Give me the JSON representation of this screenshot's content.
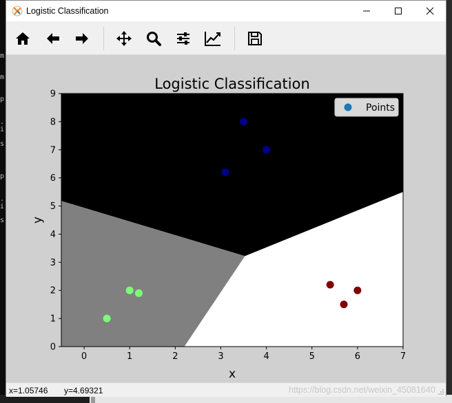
{
  "window": {
    "title": "Logistic Classification",
    "controls": [
      "minimize",
      "maximize",
      "close"
    ]
  },
  "toolbar": {
    "buttons": [
      {
        "icon": "home-icon"
      },
      {
        "icon": "back-arrow-icon"
      },
      {
        "icon": "forward-arrow-icon"
      },
      {
        "icon": "pan-icon"
      },
      {
        "icon": "zoom-icon"
      },
      {
        "icon": "configure-subplots-icon"
      },
      {
        "icon": "edit-axis-icon"
      },
      {
        "icon": "save-icon"
      }
    ]
  },
  "console": {
    "chars": [
      "m",
      "m",
      "p",
      ".",
      "i",
      "s",
      "p",
      ".",
      "i",
      "s"
    ]
  },
  "status": {
    "x": "x=1.05746",
    "y": "y=4.69321",
    "watermark": "https://blog.csdn.net/weixin_45081640"
  },
  "chart_data": {
    "type": "scatter",
    "title": "Logistic Classification",
    "xlabel": "x",
    "ylabel": "y",
    "xlim": [
      -0.5,
      7
    ],
    "ylim": [
      0,
      9
    ],
    "xticks": [
      "0",
      "1",
      "2",
      "3",
      "4",
      "5",
      "6",
      "7"
    ],
    "yticks": [
      "0",
      "1",
      "2",
      "3",
      "4",
      "5",
      "6",
      "7",
      "8",
      "9"
    ],
    "legend": {
      "label": "Points",
      "position": "top-right"
    },
    "background_regions": [
      {
        "class": "top",
        "color": "#000000"
      },
      {
        "class": "left",
        "color": "#808080"
      },
      {
        "class": "right",
        "color": "#ffffff"
      }
    ],
    "region_boundary": [
      [
        -0.5,
        5.18
      ],
      [
        3.53,
        3.22
      ],
      [
        7,
        5.5
      ],
      [
        3.53,
        3.22
      ],
      [
        2.2,
        0
      ]
    ],
    "series": [
      {
        "color": "#00008b",
        "points": [
          [
            3.5,
            8.0
          ],
          [
            4.0,
            7.0
          ],
          [
            3.1,
            6.2
          ]
        ]
      },
      {
        "color": "#7cfc78",
        "points": [
          [
            1.0,
            2.0
          ],
          [
            1.2,
            1.9
          ],
          [
            0.5,
            1.0
          ]
        ]
      },
      {
        "color": "#800000",
        "points": [
          [
            5.4,
            2.2
          ],
          [
            5.7,
            1.5
          ],
          [
            6.0,
            2.0
          ]
        ]
      }
    ],
    "legend_marker_color": "#1f77b4",
    "grid": false
  }
}
